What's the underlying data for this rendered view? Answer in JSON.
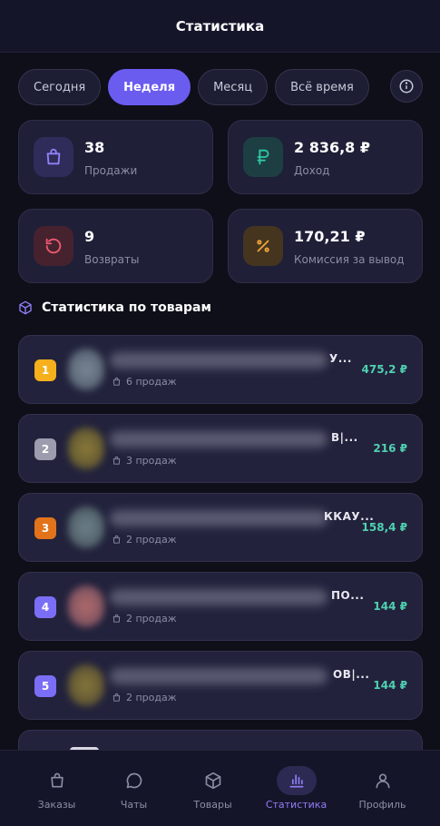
{
  "header": {
    "title": "Статистика"
  },
  "tabs": [
    {
      "label": "Сегодня",
      "active": false
    },
    {
      "label": "Неделя",
      "active": true
    },
    {
      "label": "Месяц",
      "active": false
    },
    {
      "label": "Всё время",
      "active": false
    }
  ],
  "info_icon": "info-icon",
  "cards": [
    {
      "value": "38",
      "label": "Продажи",
      "icon": "shopping-bag-icon",
      "accent": "#7b6ef6"
    },
    {
      "value": "2 836,8 ₽",
      "label": "Доход",
      "icon": "ruble-icon",
      "accent": "#2fc7a7"
    },
    {
      "value": "9",
      "label": "Возвраты",
      "icon": "refresh-icon",
      "accent": "#ef5a6f"
    },
    {
      "value": "170,21 ₽",
      "label": "Комиссия за вывод",
      "icon": "percent-icon",
      "accent": "#f2a53a"
    }
  ],
  "section": {
    "title": "Статистика по товарам",
    "icon": "box-icon"
  },
  "products": [
    {
      "rank": "1",
      "rank_color": "#f5b01c",
      "name_tail": "У...",
      "sales": "6 продаж",
      "price": "475,2 ₽"
    },
    {
      "rank": "2",
      "rank_color": "#9c9cae",
      "name_tail": "В|...",
      "sales": "3 продаж",
      "price": "216 ₽"
    },
    {
      "rank": "3",
      "rank_color": "#e2731a",
      "name_tail": "ККАУ...",
      "sales": "2 продаж",
      "price": "158,4 ₽"
    },
    {
      "rank": "4",
      "rank_color": "#7b6ef6",
      "name_tail": "ПО...",
      "sales": "2 продаж",
      "price": "144 ₽"
    },
    {
      "rank": "5",
      "rank_color": "#7b6ef6",
      "name_tail": "ОВ|...",
      "sales": "2 продаж",
      "price": "144 ₽"
    }
  ],
  "nav": [
    {
      "label": "Заказы",
      "icon": "shopping-bag-icon",
      "active": false
    },
    {
      "label": "Чаты",
      "icon": "chat-icon",
      "active": false
    },
    {
      "label": "Товары",
      "icon": "box-icon",
      "active": false
    },
    {
      "label": "Статистика",
      "icon": "bar-chart-icon",
      "active": true
    },
    {
      "label": "Профиль",
      "icon": "user-icon",
      "active": false
    }
  ],
  "colors": {
    "accent": "#6b5cf0",
    "price": "#4fd1b0",
    "background": "#0f0f1a"
  }
}
